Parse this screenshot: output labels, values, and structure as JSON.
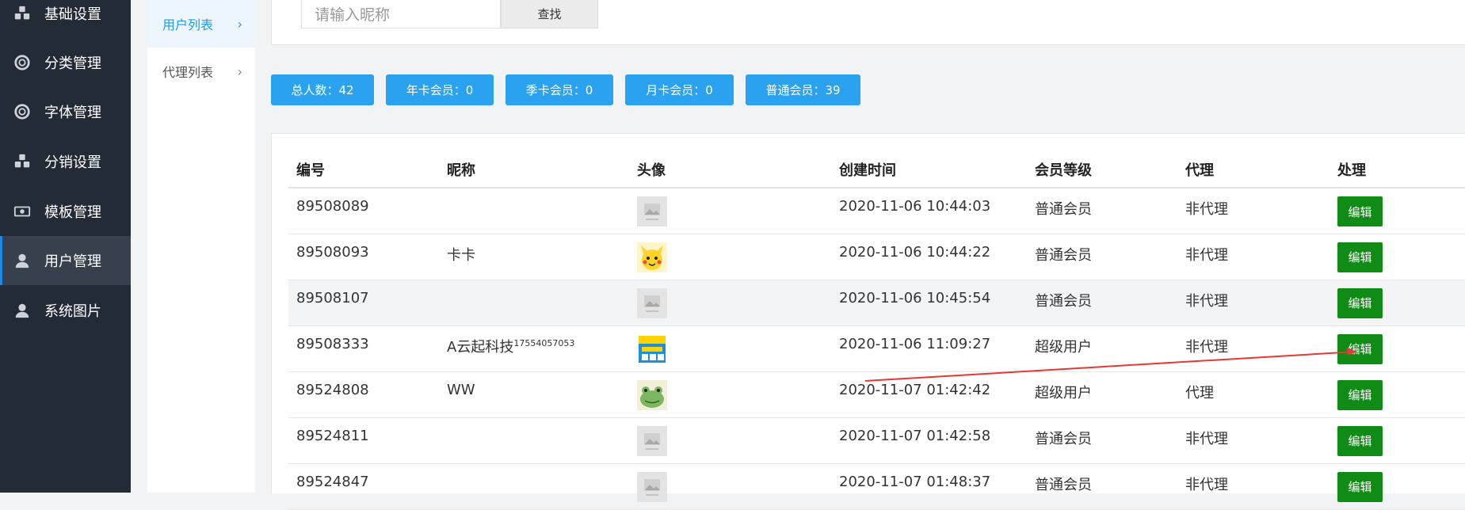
{
  "sidebar": {
    "items": [
      {
        "label": "基础设置",
        "icon": "cubes-icon"
      },
      {
        "label": "分类管理",
        "icon": "lifebuoy-icon"
      },
      {
        "label": "字体管理",
        "icon": "lifebuoy-icon"
      },
      {
        "label": "分销设置",
        "icon": "cubes-icon"
      },
      {
        "label": "模板管理",
        "icon": "money-icon"
      },
      {
        "label": "用户管理",
        "icon": "user-icon",
        "active": true
      },
      {
        "label": "系统图片",
        "icon": "user-icon"
      }
    ]
  },
  "submenu": {
    "items": [
      {
        "label": "用户列表",
        "active": true
      },
      {
        "label": "代理列表"
      }
    ]
  },
  "search": {
    "placeholder": "请输入昵称",
    "button": "查找"
  },
  "stats": [
    {
      "label": "总人数：42"
    },
    {
      "label": "年卡会员：0"
    },
    {
      "label": "季卡会员：0"
    },
    {
      "label": "月卡会员：0"
    },
    {
      "label": "普通会员：39"
    }
  ],
  "table": {
    "headers": [
      "编号",
      "昵称",
      "头像",
      "创建时间",
      "会员等级",
      "代理",
      "处理"
    ],
    "edit_label": "编辑",
    "rows": [
      {
        "id": "89508089",
        "nickname": "",
        "nickname_sup": "",
        "avatar": "placeholder",
        "created": "2020-11-06 10:44:03",
        "level": "普通会员",
        "agent": "非代理"
      },
      {
        "id": "89508093",
        "nickname": "卡卡",
        "nickname_sup": "",
        "avatar": "pikachu",
        "created": "2020-11-06 10:44:22",
        "level": "普通会员",
        "agent": "非代理"
      },
      {
        "id": "89508107",
        "nickname": "",
        "nickname_sup": "",
        "avatar": "placeholder",
        "created": "2020-11-06 10:45:54",
        "level": "普通会员",
        "agent": "非代理"
      },
      {
        "id": "89508333",
        "nickname": "A云起科技",
        "nickname_sup": "17554057053",
        "avatar": "book",
        "created": "2020-11-06 11:09:27",
        "level": "超级用户",
        "agent": "非代理"
      },
      {
        "id": "89524808",
        "nickname": "WW",
        "nickname_sup": "",
        "avatar": "frog",
        "created": "2020-11-07 01:42:42",
        "level": "超级用户",
        "agent": "代理"
      },
      {
        "id": "89524811",
        "nickname": "",
        "nickname_sup": "",
        "avatar": "placeholder",
        "created": "2020-11-07 01:42:58",
        "level": "普通会员",
        "agent": "非代理"
      },
      {
        "id": "89524847",
        "nickname": "",
        "nickname_sup": "",
        "avatar": "placeholder",
        "created": "2020-11-07 01:48:37",
        "level": "普通会员",
        "agent": "非代理"
      }
    ]
  },
  "colors": {
    "sidebar_bg": "#232b37",
    "accent": "#2aa2f0",
    "edit_button": "#0f8b16",
    "annotation": "#e53935"
  }
}
